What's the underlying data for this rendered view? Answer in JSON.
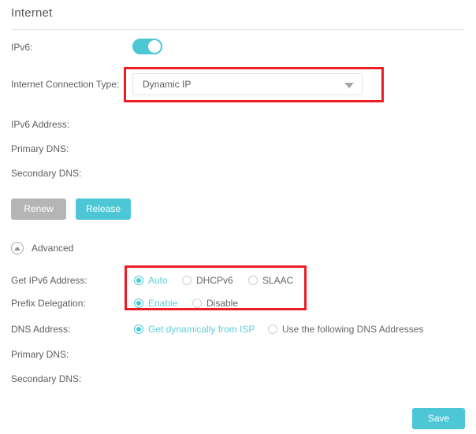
{
  "page": {
    "title": "Internet"
  },
  "ipv6": {
    "label": "IPv6:",
    "toggle_state": "on",
    "toggle_color": "#4dc7d6"
  },
  "connection_type": {
    "label": "Internet Connection Type:",
    "value": "Dynamic IP",
    "caret_icon": "chevron-down-icon"
  },
  "readonly_fields": [
    {
      "label": "IPv6 Address:",
      "value": ""
    },
    {
      "label": "Primary DNS:",
      "value": ""
    },
    {
      "label": "Secondary DNS:",
      "value": ""
    }
  ],
  "buttons": {
    "renew": {
      "label": "Renew",
      "state": "disabled",
      "color": "#b5b5b5"
    },
    "release": {
      "label": "Release",
      "state": "enabled",
      "color": "#4dc7d6"
    },
    "save": {
      "label": "Save",
      "state": "enabled",
      "color": "#4dc7d6"
    }
  },
  "advanced": {
    "label": "Advanced",
    "icon": "chevron-up-circle-icon",
    "expanded": true
  },
  "get_ipv6_address": {
    "label": "Get IPv6 Address:",
    "options": [
      {
        "label": "Auto",
        "selected": true
      },
      {
        "label": "DHCPv6",
        "selected": false
      },
      {
        "label": "SLAAC",
        "selected": false
      }
    ]
  },
  "prefix_delegation": {
    "label": "Prefix Delegation:",
    "options": [
      {
        "label": "Enable",
        "selected": true
      },
      {
        "label": "Disable",
        "selected": false
      }
    ]
  },
  "dns_address": {
    "label": "DNS Address:",
    "options": [
      {
        "label": "Get dynamically from ISP",
        "selected": true
      },
      {
        "label": "Use the following DNS Addresses",
        "selected": false
      }
    ]
  },
  "advanced_dns_fields": [
    {
      "label": "Primary DNS:",
      "value": ""
    },
    {
      "label": "Secondary DNS:",
      "value": ""
    }
  ],
  "annotations": {
    "highlight_color": "#ee1c25",
    "boxes": [
      {
        "name": "connection-type-highlight"
      },
      {
        "name": "ipv6-options-highlight"
      }
    ]
  }
}
